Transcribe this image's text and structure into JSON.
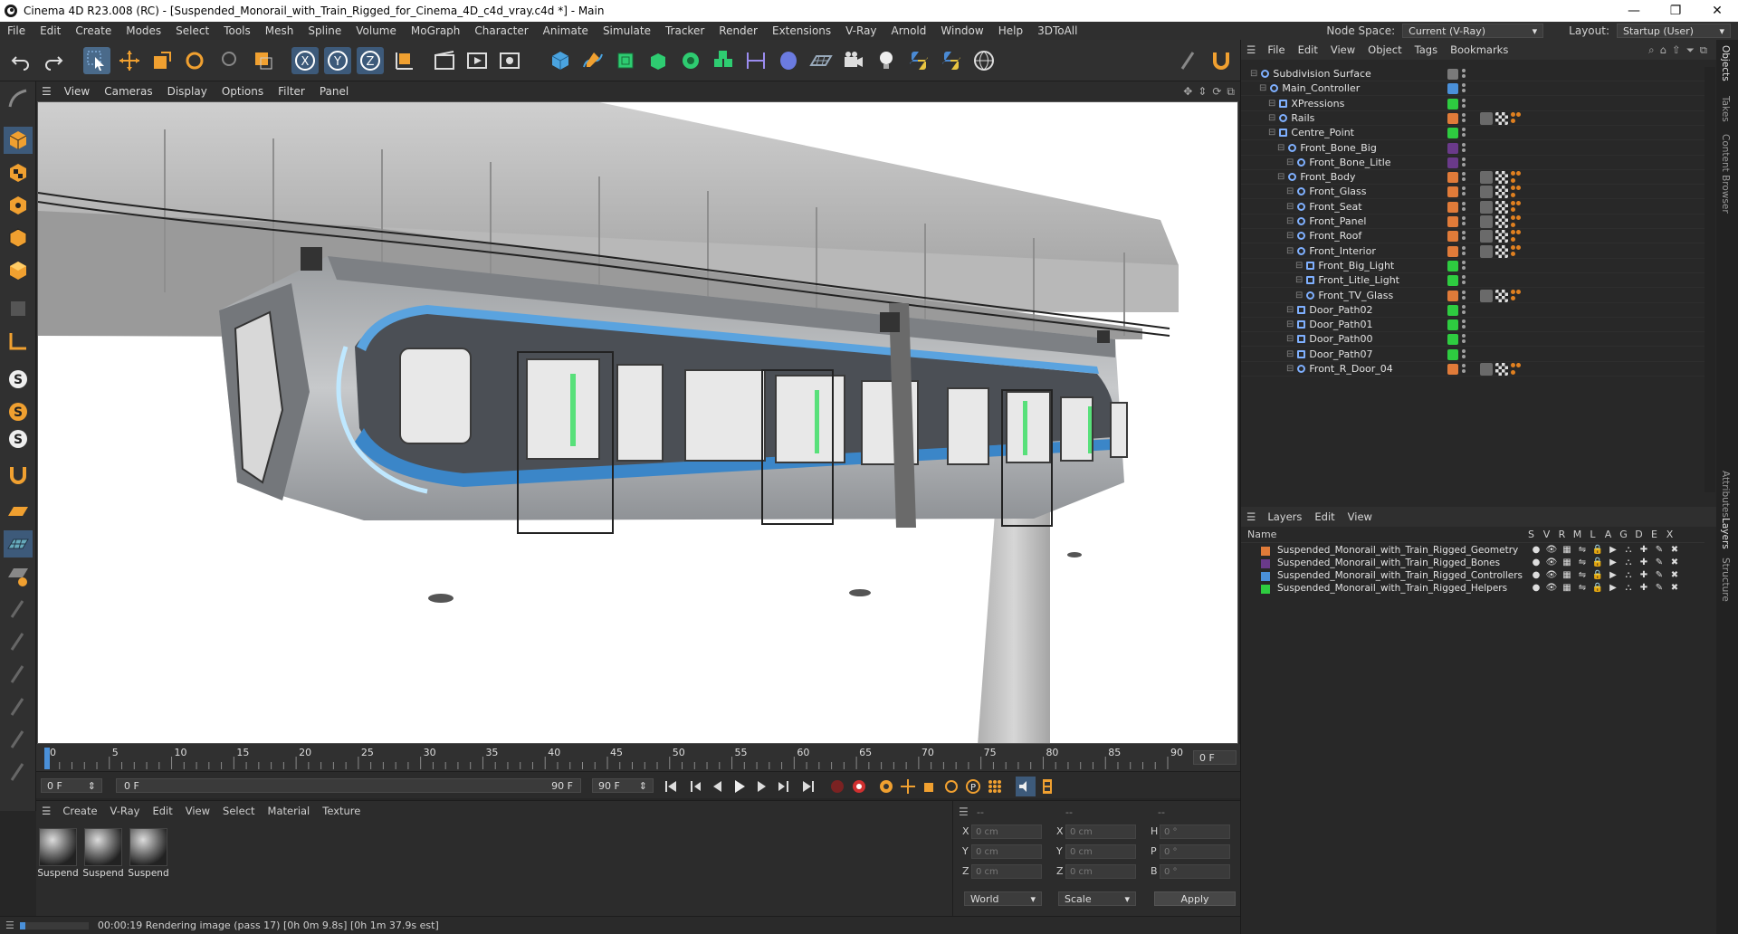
{
  "window": {
    "title": "Cinema 4D R23.008 (RC) - [Suspended_Monorail_with_Train_Rigged_for_Cinema_4D_c4d_vray.c4d *] - Main",
    "minimize": "—",
    "maximize": "❐",
    "close": "✕"
  },
  "menubar": {
    "items": [
      "File",
      "Edit",
      "Create",
      "Modes",
      "Select",
      "Tools",
      "Mesh",
      "Spline",
      "Volume",
      "MoGraph",
      "Character",
      "Animate",
      "Simulate",
      "Tracker",
      "Render",
      "Extensions",
      "V-Ray",
      "Arnold",
      "Window",
      "Help",
      "3DToAll"
    ],
    "node_space_label": "Node Space:",
    "node_space_value": "Current (V-Ray)",
    "layout_label": "Layout:",
    "layout_value": "Startup (User)"
  },
  "viewport_menu": [
    "View",
    "Cameras",
    "Display",
    "Options",
    "Filter",
    "Panel"
  ],
  "object_manager": {
    "menu": [
      "File",
      "Edit",
      "View",
      "Object",
      "Tags",
      "Bookmarks"
    ],
    "rows": [
      {
        "name": "Subdivision Surface",
        "indent": 0,
        "color": "#7a7a7a",
        "icon": "subdivision-icon",
        "tags": []
      },
      {
        "name": "Main_Controller",
        "indent": 1,
        "color": "#4a90d9",
        "icon": "spline-icon",
        "tags": []
      },
      {
        "name": "XPressions",
        "indent": 2,
        "color": "#2ecc40",
        "icon": "null-icon",
        "tags": []
      },
      {
        "name": "Rails",
        "indent": 2,
        "color": "#e07b39",
        "icon": "joint-icon",
        "tags": [
          "mat",
          "chk",
          "or"
        ]
      },
      {
        "name": "Centre_Point",
        "indent": 2,
        "color": "#2ecc40",
        "icon": "null-icon",
        "tags": []
      },
      {
        "name": "Front_Bone_Big",
        "indent": 3,
        "color": "#6a3a8a",
        "icon": "bone-icon",
        "tags": []
      },
      {
        "name": "Front_Bone_Litle",
        "indent": 4,
        "color": "#6a3a8a",
        "icon": "bone-icon",
        "tags": []
      },
      {
        "name": "Front_Body",
        "indent": 3,
        "color": "#e07b39",
        "icon": "joint-icon",
        "tags": [
          "mat",
          "chk",
          "or"
        ]
      },
      {
        "name": "Front_Glass",
        "indent": 4,
        "color": "#e07b39",
        "icon": "joint-icon",
        "tags": [
          "mat",
          "chk",
          "or"
        ]
      },
      {
        "name": "Front_Seat",
        "indent": 4,
        "color": "#e07b39",
        "icon": "joint-icon",
        "tags": [
          "mat",
          "chk",
          "or"
        ]
      },
      {
        "name": "Front_Panel",
        "indent": 4,
        "color": "#e07b39",
        "icon": "joint-icon",
        "tags": [
          "mat",
          "chk",
          "or"
        ]
      },
      {
        "name": "Front_Roof",
        "indent": 4,
        "color": "#e07b39",
        "icon": "joint-icon",
        "tags": [
          "mat",
          "chk",
          "or"
        ]
      },
      {
        "name": "Front_Interior",
        "indent": 4,
        "color": "#e07b39",
        "icon": "joint-icon",
        "tags": [
          "mat",
          "chk",
          "or"
        ]
      },
      {
        "name": "Front_Big_Light",
        "indent": 5,
        "color": "#2ecc40",
        "icon": "null-icon",
        "tags": []
      },
      {
        "name": "Front_Litle_Light",
        "indent": 5,
        "color": "#2ecc40",
        "icon": "null-icon",
        "tags": []
      },
      {
        "name": "Front_TV_Glass",
        "indent": 5,
        "color": "#e07b39",
        "icon": "joint-icon",
        "tags": [
          "mat",
          "chk",
          "or"
        ]
      },
      {
        "name": "Door_Path02",
        "indent": 4,
        "color": "#2ecc40",
        "icon": "null-icon",
        "tags": []
      },
      {
        "name": "Door_Path01",
        "indent": 4,
        "color": "#2ecc40",
        "icon": "null-icon",
        "tags": []
      },
      {
        "name": "Door_Path00",
        "indent": 4,
        "color": "#2ecc40",
        "icon": "null-icon",
        "tags": []
      },
      {
        "name": "Door_Path07",
        "indent": 4,
        "color": "#2ecc40",
        "icon": "null-icon",
        "tags": []
      },
      {
        "name": "Front_R_Door_04",
        "indent": 4,
        "color": "#e07b39",
        "icon": "joint-icon",
        "tags": [
          "mat",
          "chk",
          "or"
        ]
      }
    ]
  },
  "layers": {
    "menu": [
      "Layers",
      "Edit",
      "View"
    ],
    "columns": {
      "name": "Name",
      "flags": [
        "S",
        "V",
        "R",
        "M",
        "L",
        "A",
        "G",
        "D",
        "E",
        "X"
      ]
    },
    "rows": [
      {
        "name": "Suspended_Monorail_with_Train_Rigged_Geometry",
        "color": "#e07b39"
      },
      {
        "name": "Suspended_Monorail_with_Train_Rigged_Bones",
        "color": "#6a3a8a"
      },
      {
        "name": "Suspended_Monorail_with_Train_Rigged_Controllers",
        "color": "#4a90d9"
      },
      {
        "name": "Suspended_Monorail_with_Train_Rigged_Helpers",
        "color": "#2ecc40"
      }
    ]
  },
  "right_tabs": [
    "Objects",
    "Takes",
    "Content Browser",
    "Attributes",
    "Layers",
    "Structure"
  ],
  "timeline": {
    "ticks": [
      0,
      5,
      10,
      15,
      20,
      25,
      30,
      35,
      40,
      45,
      50,
      55,
      60,
      65,
      70,
      75,
      80,
      85,
      90
    ],
    "current_frame": "0 F",
    "start_field": "0 F",
    "range_start": "0 F",
    "range_end": "90 F",
    "end_field": "90 F"
  },
  "material_manager": {
    "menu": [
      "Create",
      "V-Ray",
      "Edit",
      "View",
      "Select",
      "Material",
      "Texture"
    ],
    "materials": [
      "Suspend",
      "Suspend",
      "Suspend"
    ]
  },
  "coordinates": {
    "dashes": [
      "--",
      "--",
      "--"
    ],
    "rows": [
      {
        "a": "X",
        "av": "0 cm",
        "b": "X",
        "bv": "0 cm",
        "c": "H",
        "cv": "0 °"
      },
      {
        "a": "Y",
        "av": "0 cm",
        "b": "Y",
        "bv": "0 cm",
        "c": "P",
        "cv": "0 °"
      },
      {
        "a": "Z",
        "av": "0 cm",
        "b": "Z",
        "bv": "0 cm",
        "c": "B",
        "cv": "0 °"
      }
    ],
    "world": "World",
    "scale": "Scale",
    "apply": "Apply"
  },
  "status": {
    "text": "00:00:19 Rendering image (pass 17) [0h  0m  9.8s] [0h  1m 37.9s est]"
  }
}
